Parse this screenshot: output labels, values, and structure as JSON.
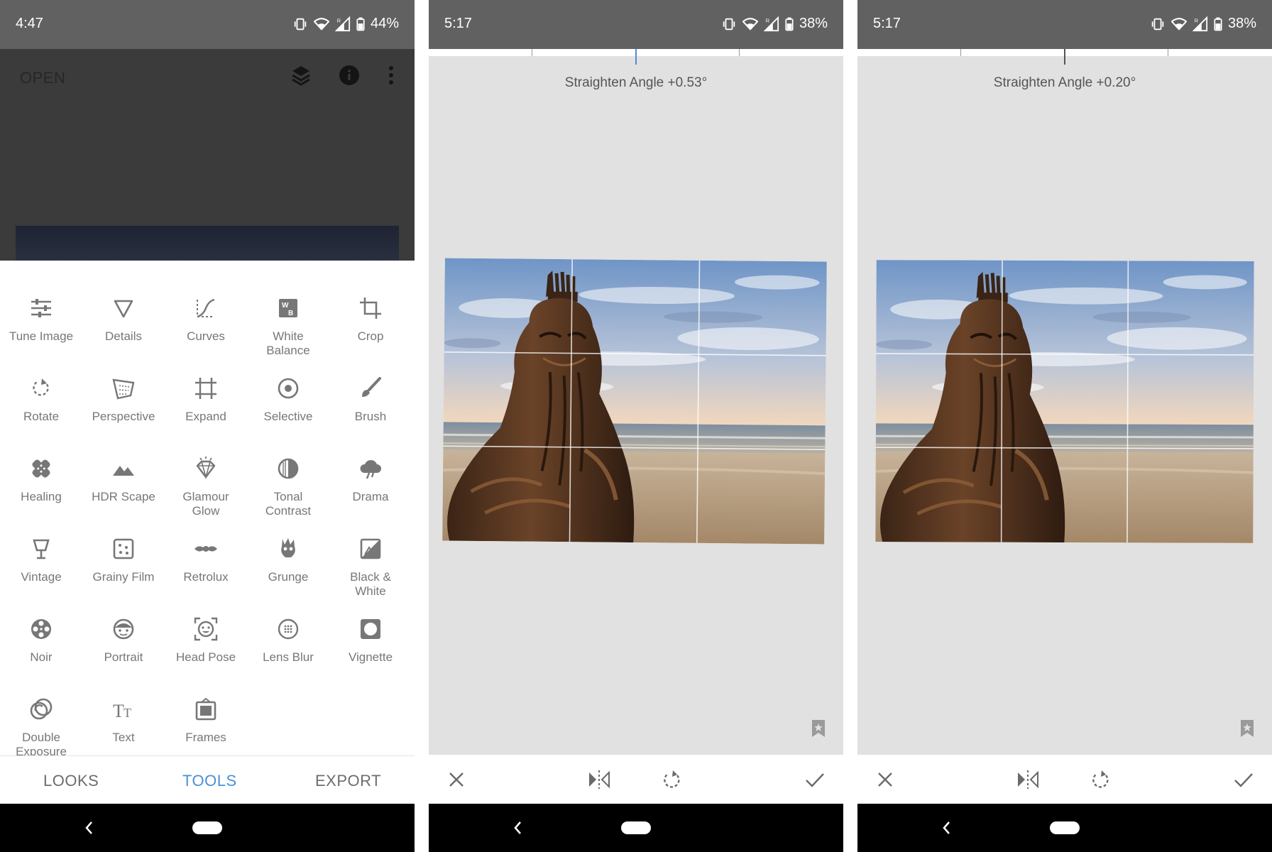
{
  "screen1": {
    "status": {
      "time": "4:47",
      "battery": "44%"
    },
    "header": {
      "open_label": "OPEN"
    },
    "tools": [
      {
        "label": "Tune Image",
        "icon": "tune-icon"
      },
      {
        "label": "Details",
        "icon": "details-triangle-icon"
      },
      {
        "label": "Curves",
        "icon": "curves-icon"
      },
      {
        "label": "White\nBalance",
        "icon": "white-balance-icon"
      },
      {
        "label": "Crop",
        "icon": "crop-icon"
      },
      {
        "label": "Rotate",
        "icon": "rotate-icon"
      },
      {
        "label": "Perspective",
        "icon": "perspective-icon"
      },
      {
        "label": "Expand",
        "icon": "expand-icon"
      },
      {
        "label": "Selective",
        "icon": "selective-icon"
      },
      {
        "label": "Brush",
        "icon": "brush-icon"
      },
      {
        "label": "Healing",
        "icon": "healing-icon"
      },
      {
        "label": "HDR Scape",
        "icon": "mountains-icon"
      },
      {
        "label": "Glamour\nGlow",
        "icon": "diamond-icon"
      },
      {
        "label": "Tonal\nContrast",
        "icon": "tonal-contrast-icon"
      },
      {
        "label": "Drama",
        "icon": "cloud-icon"
      },
      {
        "label": "Vintage",
        "icon": "lamp-icon"
      },
      {
        "label": "Grainy Film",
        "icon": "grainy-film-icon"
      },
      {
        "label": "Retrolux",
        "icon": "mustache-icon"
      },
      {
        "label": "Grunge",
        "icon": "grunge-icon"
      },
      {
        "label": "Black &\nWhite",
        "icon": "black-white-icon"
      },
      {
        "label": "Noir",
        "icon": "film-reel-icon"
      },
      {
        "label": "Portrait",
        "icon": "face-icon"
      },
      {
        "label": "Head Pose",
        "icon": "head-pose-icon"
      },
      {
        "label": "Lens Blur",
        "icon": "lens-blur-icon"
      },
      {
        "label": "Vignette",
        "icon": "vignette-icon"
      },
      {
        "label": "Double\nExposure",
        "icon": "double-exposure-icon"
      },
      {
        "label": "Text",
        "icon": "text-icon"
      },
      {
        "label": "Frames",
        "icon": "frames-icon"
      }
    ],
    "tabs": {
      "looks": "LOOKS",
      "tools": "TOOLS",
      "export": "EXPORT"
    },
    "accent_color": "#4a90d9"
  },
  "screen2": {
    "status": {
      "time": "5:17",
      "battery": "38%"
    },
    "angle_label": "Straighten Angle +0.53°"
  },
  "screen3": {
    "status": {
      "time": "5:17",
      "battery": "38%"
    },
    "angle_label": "Straighten Angle +0.20°"
  }
}
